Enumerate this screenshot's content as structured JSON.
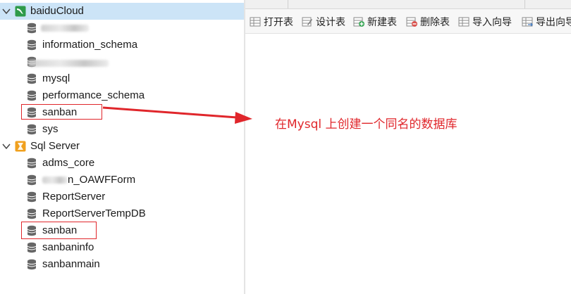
{
  "tree": {
    "connections": [
      {
        "name": "baiduCloud",
        "icon": "mysql-connection-icon",
        "expanded": true,
        "databases": [
          "",
          "information_schema",
          "",
          "mysql",
          "performance_schema",
          "sanban",
          "sys"
        ]
      },
      {
        "name": "Sql Server",
        "icon": "sqlserver-connection-icon",
        "expanded": true,
        "databases": [
          "adms_core",
          "n_OAWFForm",
          "ReportServer",
          "ReportServerTempDB",
          "sanban",
          "sanbaninfo",
          "sanbanmain"
        ]
      }
    ]
  },
  "toolbar": {
    "open_table": "打开表",
    "design_table": "设计表",
    "new_table": "新建表",
    "delete_table": "删除表",
    "import_wizard": "导入向导",
    "export_wizard": "导出向导"
  },
  "annotation": {
    "text": "在Mysql 上创建一个同名的数据库",
    "color": "#e0262b"
  },
  "colors": {
    "selection": "#cce4f7",
    "annotation_red": "#e0262b",
    "mysql_icon_green": "#2e9b4a",
    "sqlserver_icon_orange": "#f0a01e"
  }
}
